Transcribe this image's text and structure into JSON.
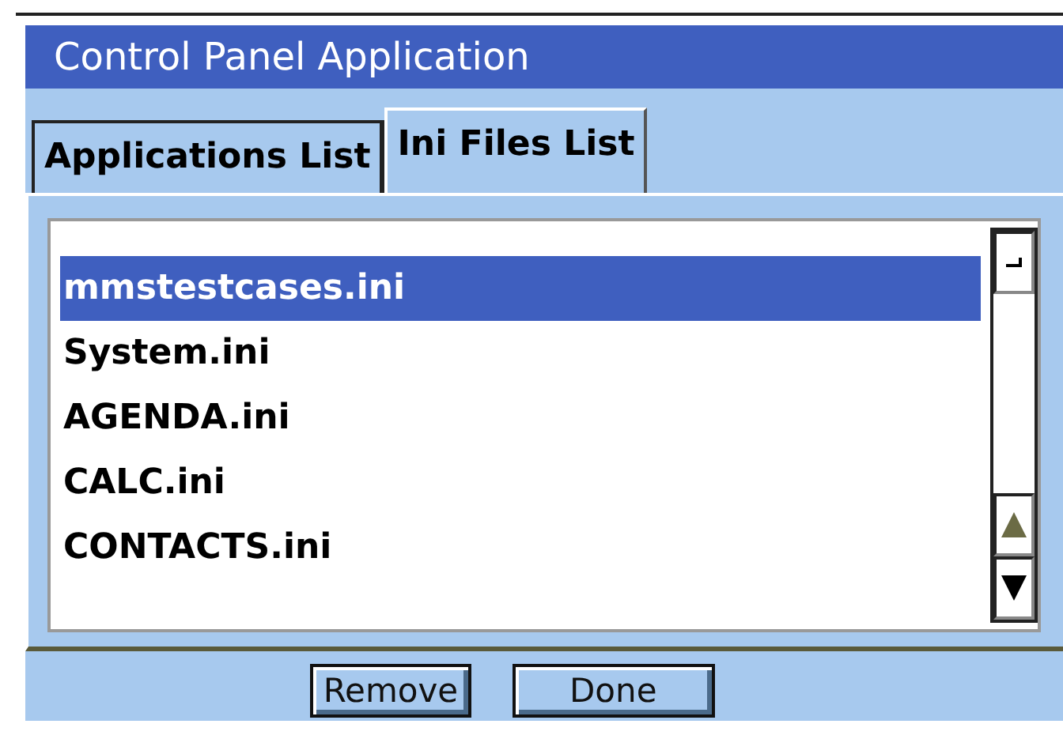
{
  "window": {
    "title": "Control Panel Application"
  },
  "tabs": [
    {
      "label": "Applications List",
      "selected": false
    },
    {
      "label": "Ini Files List",
      "selected": true
    }
  ],
  "files": [
    {
      "name": "mmstestcases.ini",
      "selected": true
    },
    {
      "name": "System.ini",
      "selected": false
    },
    {
      "name": "AGENDA.ini",
      "selected": false
    },
    {
      "name": "CALC.ini",
      "selected": false
    },
    {
      "name": "CONTACTS.ini",
      "selected": false
    }
  ],
  "buttons": [
    "Remove",
    "Done"
  ]
}
